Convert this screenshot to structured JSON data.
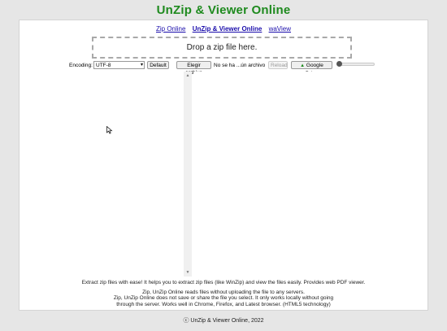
{
  "site": {
    "title": "UnZip & Viewer Online"
  },
  "nav": {
    "items": [
      {
        "label": "Zip Online"
      },
      {
        "label": "UnZip & Viewer Online"
      },
      {
        "label": "waView"
      }
    ]
  },
  "dropzone": {
    "label": "Drop a zip file here."
  },
  "toolbar": {
    "encoding_label": "Encoding:",
    "encoding_value": "UTF-8",
    "default_label": "Default",
    "choose_file_label": "Elegir archivo",
    "no_file_text": "No se ha ...ún archivo",
    "reload_label": "Reload",
    "gdrive_label": "Google Drive"
  },
  "description": "Extract zip files with ease! It helps you to extract zip files (like WinZip) and view the files easily. Provides web PDF viewer.",
  "info": {
    "line1": "Zip, UnZip Online reads files without uploading the file to any servers.",
    "line2": "Zip, UnZip Online does not save or share the file you select. It only works locally without going",
    "line3": "through the server. Works well in Chrome, Firefox, and Latest browser. (HTML5 technology)"
  },
  "footer": "ⓒ UnZip & Viewer Online, 2022",
  "colors": {
    "title": "#1e8a1e",
    "link": "#1a0dab",
    "background": "#e6e6e6"
  }
}
